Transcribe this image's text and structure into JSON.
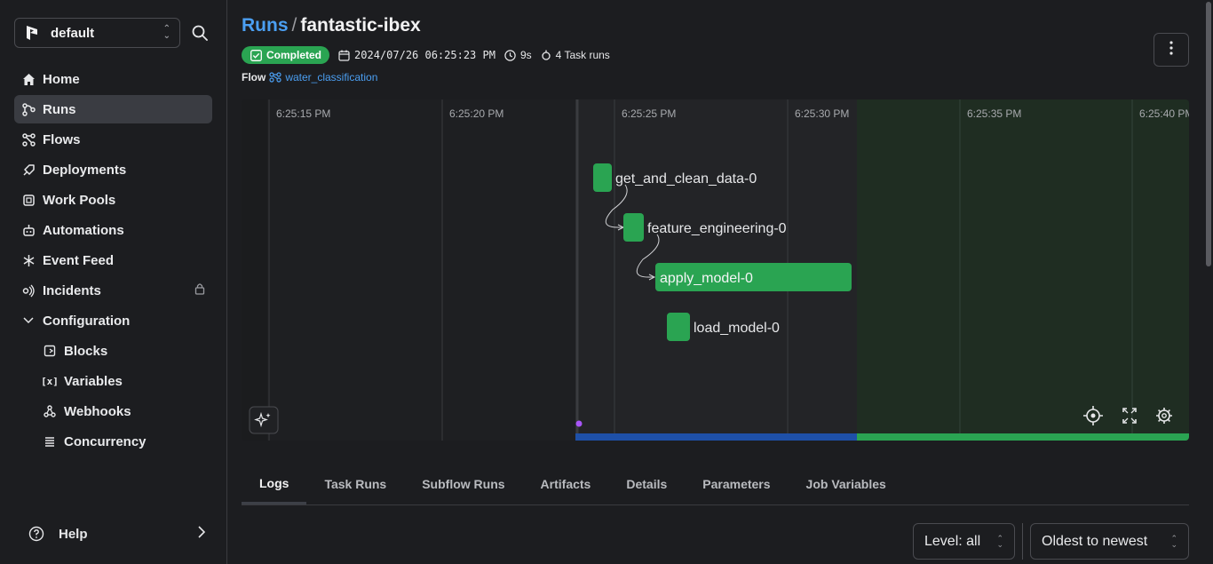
{
  "sidebar": {
    "workspace": "default",
    "items": [
      {
        "label": "Home",
        "icon": "home-icon"
      },
      {
        "label": "Runs",
        "icon": "runs-icon"
      },
      {
        "label": "Flows",
        "icon": "flows-icon"
      },
      {
        "label": "Deployments",
        "icon": "deployments-icon"
      },
      {
        "label": "Work Pools",
        "icon": "work-pools-icon"
      },
      {
        "label": "Automations",
        "icon": "automations-icon"
      },
      {
        "label": "Event Feed",
        "icon": "event-feed-icon"
      },
      {
        "label": "Incidents",
        "icon": "incidents-icon"
      },
      {
        "label": "Configuration",
        "icon": "chevron-down-icon"
      },
      {
        "label": "Blocks",
        "icon": "blocks-icon"
      },
      {
        "label": "Variables",
        "icon": "variables-icon"
      },
      {
        "label": "Webhooks",
        "icon": "webhooks-icon"
      },
      {
        "label": "Concurrency",
        "icon": "concurrency-icon"
      }
    ],
    "active": "Runs",
    "help": "Help"
  },
  "header": {
    "breadcrumb": "Runs",
    "separator": "/",
    "run_name": "fantastic-ibex",
    "status": "Completed",
    "timestamp": "2024/07/26 06:25:23 PM",
    "duration": "9s",
    "task_runs": "4 Task runs",
    "flow_label": "Flow",
    "flow_name": "water_classification"
  },
  "timeline": {
    "ticks": [
      "6:25:15 PM",
      "6:25:20 PM",
      "6:25:25 PM",
      "6:25:30 PM",
      "6:25:35 PM",
      "6:25:40 PM"
    ],
    "tasks": [
      {
        "name": "get_and_clean_data-0"
      },
      {
        "name": "feature_engineering-0"
      },
      {
        "name": "apply_model-0"
      },
      {
        "name": "load_model-0"
      }
    ],
    "colors": {
      "completed": "#2aa452",
      "running_bar": "#1e50a8",
      "marker": "#a855f7"
    }
  },
  "tabs": [
    "Logs",
    "Task Runs",
    "Subflow Runs",
    "Artifacts",
    "Details",
    "Parameters",
    "Job Variables"
  ],
  "active_tab": "Logs",
  "filters": {
    "level": "Level: all",
    "sort": "Oldest to newest"
  }
}
